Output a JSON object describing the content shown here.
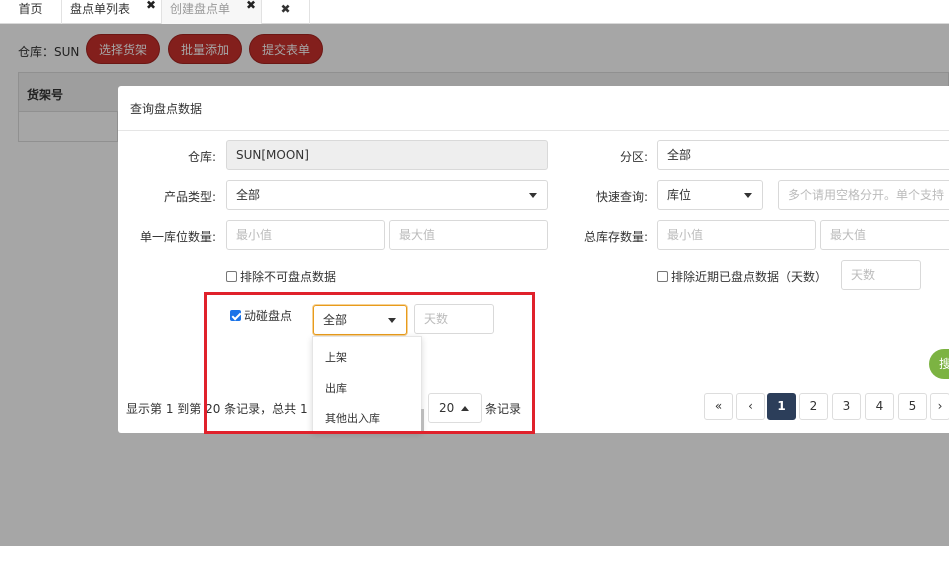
{
  "tabs": [
    {
      "label": "首页"
    },
    {
      "label": "盘点单列表"
    },
    {
      "label": "创建盘点单"
    },
    {
      "label": ""
    }
  ],
  "close_glyph": "✖",
  "toolbar": {
    "warehouse_label": "仓库：SUN",
    "select_shelf": "选择货架",
    "batch_add": "批量添加",
    "submit_form": "提交表单"
  },
  "grid": {
    "column_1": "货架号"
  },
  "modal": {
    "title": "查询盘点数据",
    "warehouse_label": "仓库:",
    "warehouse_value": "SUN[MOON]",
    "zone_label": "分区:",
    "zone_value": "全部",
    "product_type_label": "产品类型:",
    "product_type_value": "全部",
    "quick_query_label": "快速查询:",
    "quick_query_value": "库位",
    "quick_query_placeholder": "多个请用空格分开。单个支持",
    "single_qty_label": "单一库位数量:",
    "single_qty_min_ph": "最小值",
    "single_qty_max_ph": "最大值",
    "total_qty_label": "总库存数量:",
    "total_qty_min_ph": "最小值",
    "total_qty_max_ph": "最大值",
    "exclude_uncountable": "排除不可盘点数据",
    "exclude_recent": "排除近期已盘点数据（天数）",
    "days_placeholder": "天数",
    "dynamic_count": "动碰盘点",
    "dynamic_select_value": "全部",
    "dynamic_days_placeholder": "天数",
    "dropdown_options": [
      "上架",
      "出库",
      "其他出入库"
    ],
    "search_button_partial": "搜",
    "pager": {
      "info_left": "显示第 1 到第 20 条记录，总共 1",
      "page_size": "20",
      "suffix": "条记录",
      "first": "«",
      "prev": "‹",
      "pages": [
        "1",
        "2",
        "3",
        "4",
        "5"
      ],
      "next": "›",
      "current_page": "1"
    }
  },
  "colors": {
    "accent_red_button": "#c9302c",
    "highlight_frame": "#e0212b",
    "active_page": "#2c3e5a",
    "search_button": "#7cb342"
  }
}
